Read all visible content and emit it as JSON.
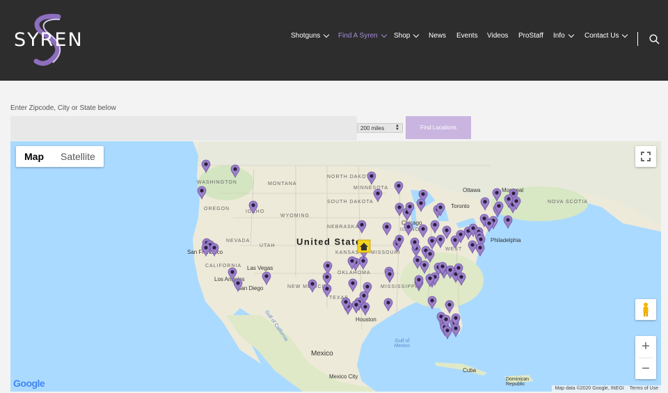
{
  "brand": {
    "logo_text": "SYREN"
  },
  "nav": {
    "items": [
      {
        "label": "Shotguns",
        "dropdown": true,
        "active": false
      },
      {
        "label": "Find A Syren",
        "dropdown": true,
        "active": true
      },
      {
        "label": "Shop",
        "dropdown": true,
        "active": false
      },
      {
        "label": "News",
        "dropdown": false,
        "active": false
      },
      {
        "label": "Events",
        "dropdown": false,
        "active": false
      },
      {
        "label": "Videos",
        "dropdown": false,
        "active": false
      },
      {
        "label": "ProStaff",
        "dropdown": false,
        "active": false
      },
      {
        "label": "Info",
        "dropdown": true,
        "active": false
      },
      {
        "label": "Contact Us",
        "dropdown": true,
        "active": false
      }
    ],
    "search_icon": "search-icon"
  },
  "locator": {
    "prompt": "Enter Zipcode, City or State below",
    "search_value": "",
    "radius": "200 miles",
    "find_button": "Find Locations"
  },
  "map": {
    "toggle": {
      "map": "Map",
      "satellite": "Satellite",
      "selected": "Map"
    },
    "zoom_in": "+",
    "zoom_out": "−",
    "google_logo": "Google",
    "attribution": "Map data ©2020 Google, INEGI",
    "terms": "Terms of Use",
    "labels": {
      "countries": [
        "United States",
        "Mexico"
      ],
      "states": [
        "WASHINGTON",
        "MONTANA",
        "NORTH DAKOTA",
        "MINNESOTA",
        "OREGON",
        "IDAHO",
        "SOUTH DAKOTA",
        "WYOMING",
        "NEBRASKA",
        "NEVADA",
        "UTAH",
        "CALIFORNIA",
        "KANSAS",
        "MISSOURI",
        "ILLINOIS",
        "OKLAHOMA",
        "TEXAS",
        "NEW MEXICO",
        "MISSISSIPPI",
        "WEST",
        "NOVA SCOTIA"
      ],
      "cities": [
        "Ottawa",
        "Montreal",
        "Toronto",
        "Chicago",
        "Philadelphia",
        "San Francisco",
        "Las Vegas",
        "Los Angeles",
        "San Diego",
        "Houston",
        "Mexico City",
        "Cuba",
        "Dominican Republic"
      ],
      "waters": [
        "Gulf of California",
        "Gulf of Mexico"
      ]
    },
    "marker_color": "#9b7fc9",
    "marker_count": 104
  },
  "colors": {
    "header_bg": "#2d2d2d",
    "accent": "#a58cd9",
    "button_bg": "#c9b5e0",
    "ocean": "#aadaff",
    "land": "#eeead9"
  }
}
